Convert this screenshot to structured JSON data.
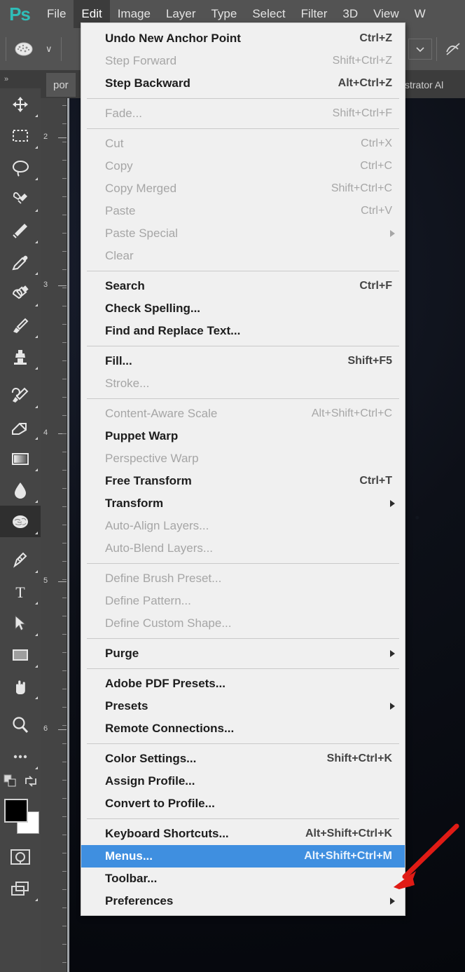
{
  "app": {
    "name": "Adobe Photoshop",
    "logo_text": "Ps",
    "logo_color": "#2fbdb8"
  },
  "menubar": {
    "items": [
      {
        "label": "File",
        "active": false
      },
      {
        "label": "Edit",
        "active": true
      },
      {
        "label": "Image",
        "active": false
      },
      {
        "label": "Layer",
        "active": false
      },
      {
        "label": "Type",
        "active": false
      },
      {
        "label": "Select",
        "active": false
      },
      {
        "label": "Filter",
        "active": false
      },
      {
        "label": "3D",
        "active": false
      },
      {
        "label": "View",
        "active": false
      },
      {
        "label": "W",
        "active": false
      }
    ]
  },
  "options_bar": {
    "brush_preset_icon": "brush-tip-icon",
    "chevron": "∨"
  },
  "document_tab": {
    "title": "por",
    "right_text": "strator Al"
  },
  "ruler": {
    "unit_marks": [
      "2",
      "3",
      "4",
      "5",
      "6"
    ]
  },
  "toolbar": {
    "grip": "»",
    "tools": [
      {
        "name": "move-tool",
        "selected": false,
        "has_corner": true
      },
      {
        "name": "rectangular-marquee-tool",
        "selected": false,
        "has_corner": true
      },
      {
        "name": "lasso-tool",
        "selected": false,
        "has_corner": true
      },
      {
        "name": "quick-selection-tool",
        "selected": false,
        "has_corner": true
      },
      {
        "name": "crop-tool",
        "selected": false,
        "has_corner": true
      },
      {
        "name": "eyedropper-tool",
        "selected": false,
        "has_corner": true
      },
      {
        "name": "spot-healing-brush-tool",
        "selected": false,
        "has_corner": true
      },
      {
        "name": "brush-tool",
        "selected": false,
        "has_corner": true
      },
      {
        "name": "clone-stamp-tool",
        "selected": false,
        "has_corner": true
      },
      {
        "name": "history-brush-tool",
        "selected": false,
        "has_corner": true
      },
      {
        "name": "eraser-tool",
        "selected": false,
        "has_corner": true
      },
      {
        "name": "gradient-tool",
        "selected": false,
        "has_corner": true
      },
      {
        "name": "blur-tool",
        "selected": false,
        "has_corner": true
      },
      {
        "name": "dodge-tool",
        "selected": true,
        "has_corner": true
      },
      {
        "name": "pen-tool",
        "selected": false,
        "has_corner": true
      },
      {
        "name": "horizontal-type-tool",
        "selected": false,
        "has_corner": true
      },
      {
        "name": "path-selection-tool",
        "selected": false,
        "has_corner": true
      },
      {
        "name": "rectangle-tool",
        "selected": false,
        "has_corner": true
      },
      {
        "name": "hand-tool",
        "selected": false,
        "has_corner": true
      },
      {
        "name": "zoom-tool",
        "selected": false,
        "has_corner": false
      },
      {
        "name": "edit-toolbar-tool",
        "selected": false,
        "has_corner": true
      }
    ],
    "colors": {
      "foreground": "#000000",
      "background": "#ffffff",
      "swap_icon": "swap-colors-icon",
      "default_icon": "default-colors-icon"
    },
    "quick_mask_name": "quick-mask-mode-icon",
    "screen_mode_name": "screen-mode-icon"
  },
  "edit_menu": {
    "title": "Edit",
    "highlight_color": "#3f8fe0",
    "groups": [
      {
        "items": [
          {
            "label": "Undo New Anchor Point",
            "shortcut": "Ctrl+Z",
            "disabled": false,
            "bold": true,
            "submenu": false,
            "highlighted": false
          },
          {
            "label": "Step Forward",
            "shortcut": "Shift+Ctrl+Z",
            "disabled": true,
            "bold": false,
            "submenu": false,
            "highlighted": false
          },
          {
            "label": "Step Backward",
            "shortcut": "Alt+Ctrl+Z",
            "disabled": false,
            "bold": true,
            "submenu": false,
            "highlighted": false
          }
        ]
      },
      {
        "items": [
          {
            "label": "Fade...",
            "shortcut": "Shift+Ctrl+F",
            "disabled": true,
            "bold": false,
            "submenu": false,
            "highlighted": false
          }
        ]
      },
      {
        "items": [
          {
            "label": "Cut",
            "shortcut": "Ctrl+X",
            "disabled": true,
            "bold": false,
            "submenu": false,
            "highlighted": false
          },
          {
            "label": "Copy",
            "shortcut": "Ctrl+C",
            "disabled": true,
            "bold": false,
            "submenu": false,
            "highlighted": false
          },
          {
            "label": "Copy Merged",
            "shortcut": "Shift+Ctrl+C",
            "disabled": true,
            "bold": false,
            "submenu": false,
            "highlighted": false
          },
          {
            "label": "Paste",
            "shortcut": "Ctrl+V",
            "disabled": true,
            "bold": false,
            "submenu": false,
            "highlighted": false
          },
          {
            "label": "Paste Special",
            "shortcut": "",
            "disabled": true,
            "bold": false,
            "submenu": true,
            "highlighted": false
          },
          {
            "label": "Clear",
            "shortcut": "",
            "disabled": true,
            "bold": false,
            "submenu": false,
            "highlighted": false
          }
        ]
      },
      {
        "items": [
          {
            "label": "Search",
            "shortcut": "Ctrl+F",
            "disabled": false,
            "bold": true,
            "submenu": false,
            "highlighted": false
          },
          {
            "label": "Check Spelling...",
            "shortcut": "",
            "disabled": false,
            "bold": true,
            "submenu": false,
            "highlighted": false
          },
          {
            "label": "Find and Replace Text...",
            "shortcut": "",
            "disabled": false,
            "bold": true,
            "submenu": false,
            "highlighted": false
          }
        ]
      },
      {
        "items": [
          {
            "label": "Fill...",
            "shortcut": "Shift+F5",
            "disabled": false,
            "bold": true,
            "submenu": false,
            "highlighted": false
          },
          {
            "label": "Stroke...",
            "shortcut": "",
            "disabled": true,
            "bold": false,
            "submenu": false,
            "highlighted": false
          }
        ]
      },
      {
        "items": [
          {
            "label": "Content-Aware Scale",
            "shortcut": "Alt+Shift+Ctrl+C",
            "disabled": true,
            "bold": false,
            "submenu": false,
            "highlighted": false
          },
          {
            "label": "Puppet Warp",
            "shortcut": "",
            "disabled": false,
            "bold": true,
            "submenu": false,
            "highlighted": false
          },
          {
            "label": "Perspective Warp",
            "shortcut": "",
            "disabled": true,
            "bold": false,
            "submenu": false,
            "highlighted": false
          },
          {
            "label": "Free Transform",
            "shortcut": "Ctrl+T",
            "disabled": false,
            "bold": true,
            "submenu": false,
            "highlighted": false
          },
          {
            "label": "Transform",
            "shortcut": "",
            "disabled": false,
            "bold": true,
            "submenu": true,
            "highlighted": false
          },
          {
            "label": "Auto-Align Layers...",
            "shortcut": "",
            "disabled": true,
            "bold": false,
            "submenu": false,
            "highlighted": false
          },
          {
            "label": "Auto-Blend Layers...",
            "shortcut": "",
            "disabled": true,
            "bold": false,
            "submenu": false,
            "highlighted": false
          }
        ]
      },
      {
        "items": [
          {
            "label": "Define Brush Preset...",
            "shortcut": "",
            "disabled": true,
            "bold": false,
            "submenu": false,
            "highlighted": false
          },
          {
            "label": "Define Pattern...",
            "shortcut": "",
            "disabled": true,
            "bold": false,
            "submenu": false,
            "highlighted": false
          },
          {
            "label": "Define Custom Shape...",
            "shortcut": "",
            "disabled": true,
            "bold": false,
            "submenu": false,
            "highlighted": false
          }
        ]
      },
      {
        "items": [
          {
            "label": "Purge",
            "shortcut": "",
            "disabled": false,
            "bold": true,
            "submenu": true,
            "highlighted": false
          }
        ]
      },
      {
        "items": [
          {
            "label": "Adobe PDF Presets...",
            "shortcut": "",
            "disabled": false,
            "bold": true,
            "submenu": false,
            "highlighted": false
          },
          {
            "label": "Presets",
            "shortcut": "",
            "disabled": false,
            "bold": true,
            "submenu": true,
            "highlighted": false
          },
          {
            "label": "Remote Connections...",
            "shortcut": "",
            "disabled": false,
            "bold": true,
            "submenu": false,
            "highlighted": false
          }
        ]
      },
      {
        "items": [
          {
            "label": "Color Settings...",
            "shortcut": "Shift+Ctrl+K",
            "disabled": false,
            "bold": true,
            "submenu": false,
            "highlighted": false
          },
          {
            "label": "Assign Profile...",
            "shortcut": "",
            "disabled": false,
            "bold": true,
            "submenu": false,
            "highlighted": false
          },
          {
            "label": "Convert to Profile...",
            "shortcut": "",
            "disabled": false,
            "bold": true,
            "submenu": false,
            "highlighted": false
          }
        ]
      },
      {
        "items": [
          {
            "label": "Keyboard Shortcuts...",
            "shortcut": "Alt+Shift+Ctrl+K",
            "disabled": false,
            "bold": true,
            "submenu": false,
            "highlighted": false
          },
          {
            "label": "Menus...",
            "shortcut": "Alt+Shift+Ctrl+M",
            "disabled": false,
            "bold": true,
            "submenu": false,
            "highlighted": true
          },
          {
            "label": "Toolbar...",
            "shortcut": "",
            "disabled": false,
            "bold": true,
            "submenu": false,
            "highlighted": false
          },
          {
            "label": "Preferences",
            "shortcut": "",
            "disabled": false,
            "bold": true,
            "submenu": true,
            "highlighted": false
          }
        ]
      }
    ]
  },
  "annotation": {
    "arrow_color": "#e01b15",
    "points_to": "Menus..."
  }
}
